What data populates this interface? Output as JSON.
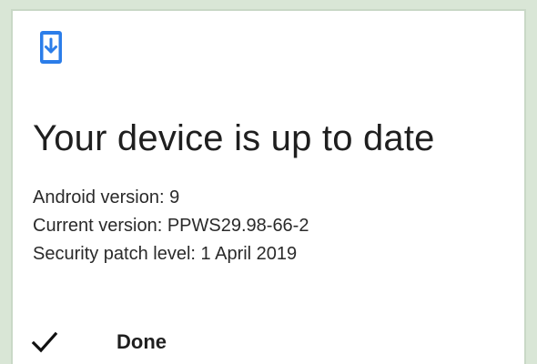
{
  "screen": {
    "icon": "system-update-icon",
    "title": "Your device is up to date",
    "details": [
      "Android version: 9",
      "Current version: PPWS29.98-66-2",
      "Security patch level: 1 April 2019"
    ],
    "done": {
      "icon": "checkmark-icon",
      "label": "Done"
    }
  },
  "colors": {
    "background": "#d9e6d6",
    "panel": "#ffffff",
    "accent": "#1a73e8",
    "text": "#1f1f1f"
  }
}
